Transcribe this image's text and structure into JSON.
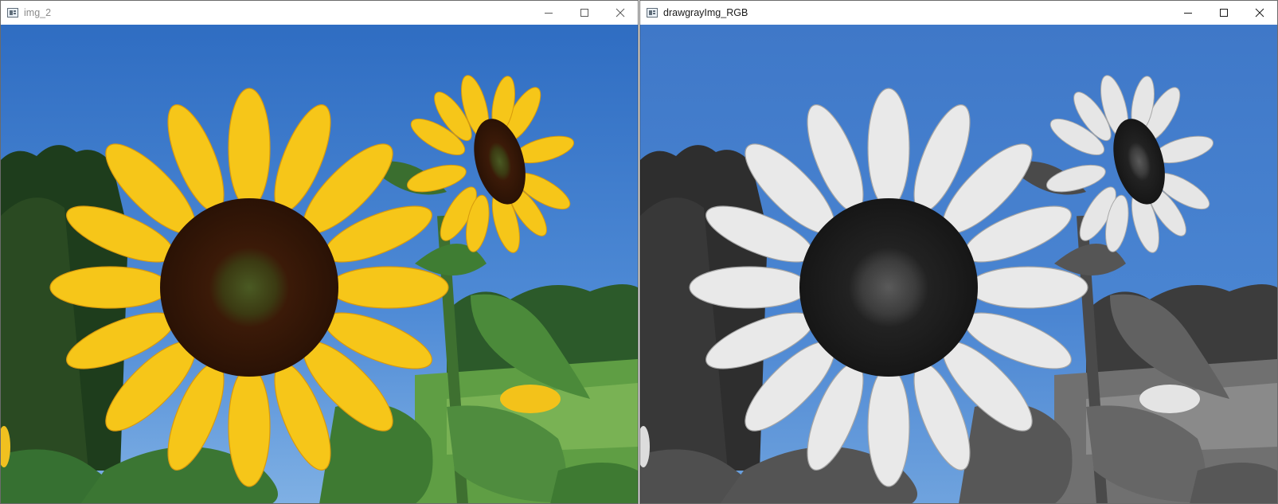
{
  "windows": [
    {
      "title": "img_2",
      "active": false,
      "controls": [
        "minimize-icon",
        "maximize-icon",
        "close-icon"
      ],
      "image": "color sunflower photo"
    },
    {
      "title": "drawgrayImg_RGB",
      "active": true,
      "controls": [
        "minimize-icon",
        "maximize-icon",
        "close-icon"
      ],
      "image": "sunflower photo in grayscale with blue sky"
    }
  ],
  "colors": {
    "sky_color": "#3f78c8",
    "petal_color": "#f6c619",
    "center_color": "#3b1a08",
    "leaf_color": "#3f7d33"
  }
}
